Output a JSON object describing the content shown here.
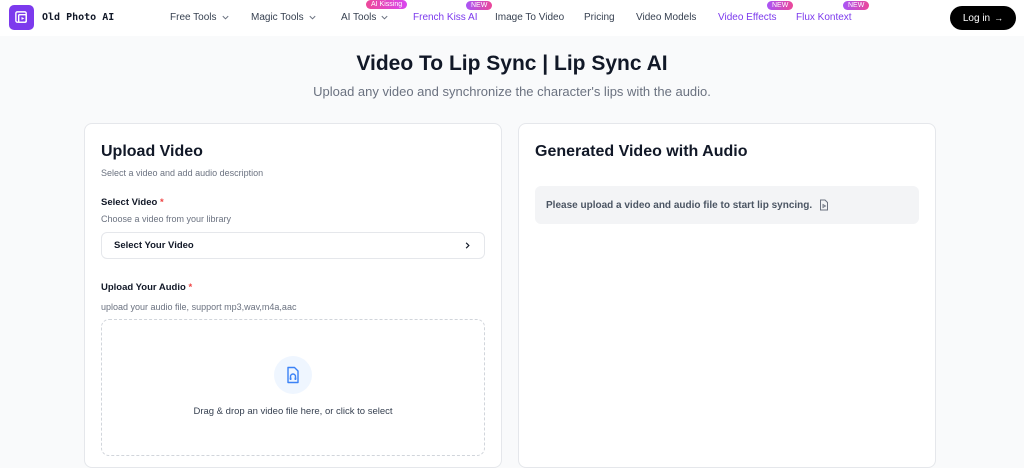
{
  "header": {
    "logo_text": "Old Photo AI",
    "nav": [
      {
        "label": "Free Tools"
      },
      {
        "label": "Magic Tools"
      },
      {
        "label": "AI Tools",
        "badge": "AI Kissing"
      },
      {
        "label": "French Kiss AI",
        "badge": "NEW"
      },
      {
        "label": "Image To Video"
      },
      {
        "label": "Pricing"
      },
      {
        "label": "Video Models"
      },
      {
        "label": "Video Effects",
        "badge": "NEW"
      },
      {
        "label": "Flux Kontext",
        "badge": "NEW"
      }
    ],
    "login_label": "Log in",
    "login_arrow": "→"
  },
  "page": {
    "title": "Video To Lip Sync | Lip Sync AI",
    "subtitle": "Upload any video and synchronize the character's lips with the audio."
  },
  "upload_card": {
    "title": "Upload Video",
    "description": "Select a video and add audio description",
    "select_video_label": "Select Video",
    "select_video_hint": "Choose a video from your library",
    "select_video_button": "Select Your Video",
    "upload_audio_label": "Upload Your Audio",
    "upload_audio_hint": "upload your audio file, support mp3,wav,m4a,aac",
    "dropzone_text": "Drag & drop an video file here, or click to select",
    "required_mark": "*"
  },
  "result_card": {
    "title": "Generated Video with Audio",
    "notice": "Please upload a video and audio file to start lip syncing."
  },
  "colors": {
    "accent": "#7c3aed",
    "badge_pink": "#ec4899",
    "required": "#ef4444"
  }
}
